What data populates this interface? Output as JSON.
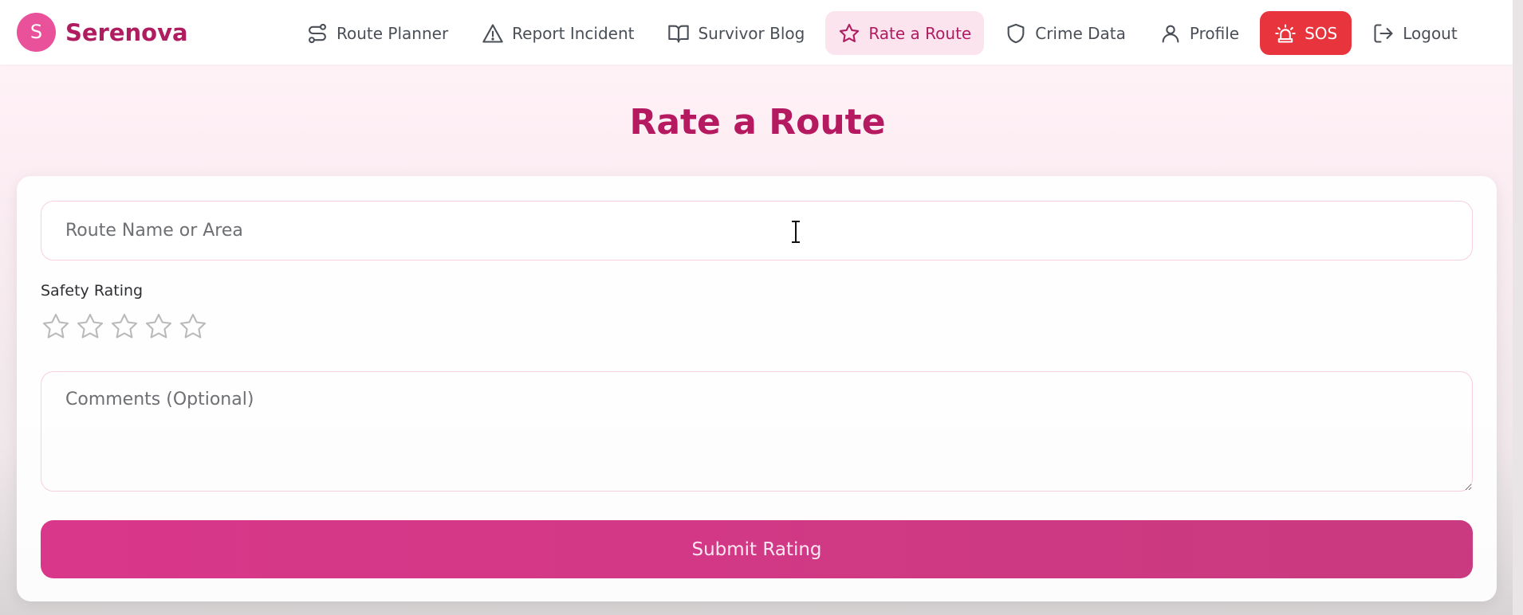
{
  "brand": {
    "initial": "S",
    "name": "Serenova",
    "color": "#b01c60"
  },
  "nav": {
    "items": [
      {
        "label": "Route Planner",
        "icon": "route-icon"
      },
      {
        "label": "Report Incident",
        "icon": "warning-triangle-icon"
      },
      {
        "label": "Survivor Blog",
        "icon": "open-book-icon"
      },
      {
        "label": "Rate a Route",
        "icon": "star-icon",
        "active": true
      },
      {
        "label": "Crime Data",
        "icon": "shield-icon"
      },
      {
        "label": "Profile",
        "icon": "user-icon"
      },
      {
        "label": "SOS",
        "icon": "siren-icon"
      },
      {
        "label": "Logout",
        "icon": "logout-icon"
      }
    ]
  },
  "page": {
    "title": "Rate a Route"
  },
  "form": {
    "route_placeholder": "Route Name or Area",
    "route_value": "",
    "rating_label": "Safety Rating",
    "rating_value": 0,
    "rating_max": 5,
    "comments_placeholder": "Comments (Optional)",
    "comments_value": "",
    "submit_label": "Submit Rating"
  },
  "colors": {
    "accent": "#b51a61",
    "sos": "#e8353d",
    "submit": "#d43886"
  }
}
